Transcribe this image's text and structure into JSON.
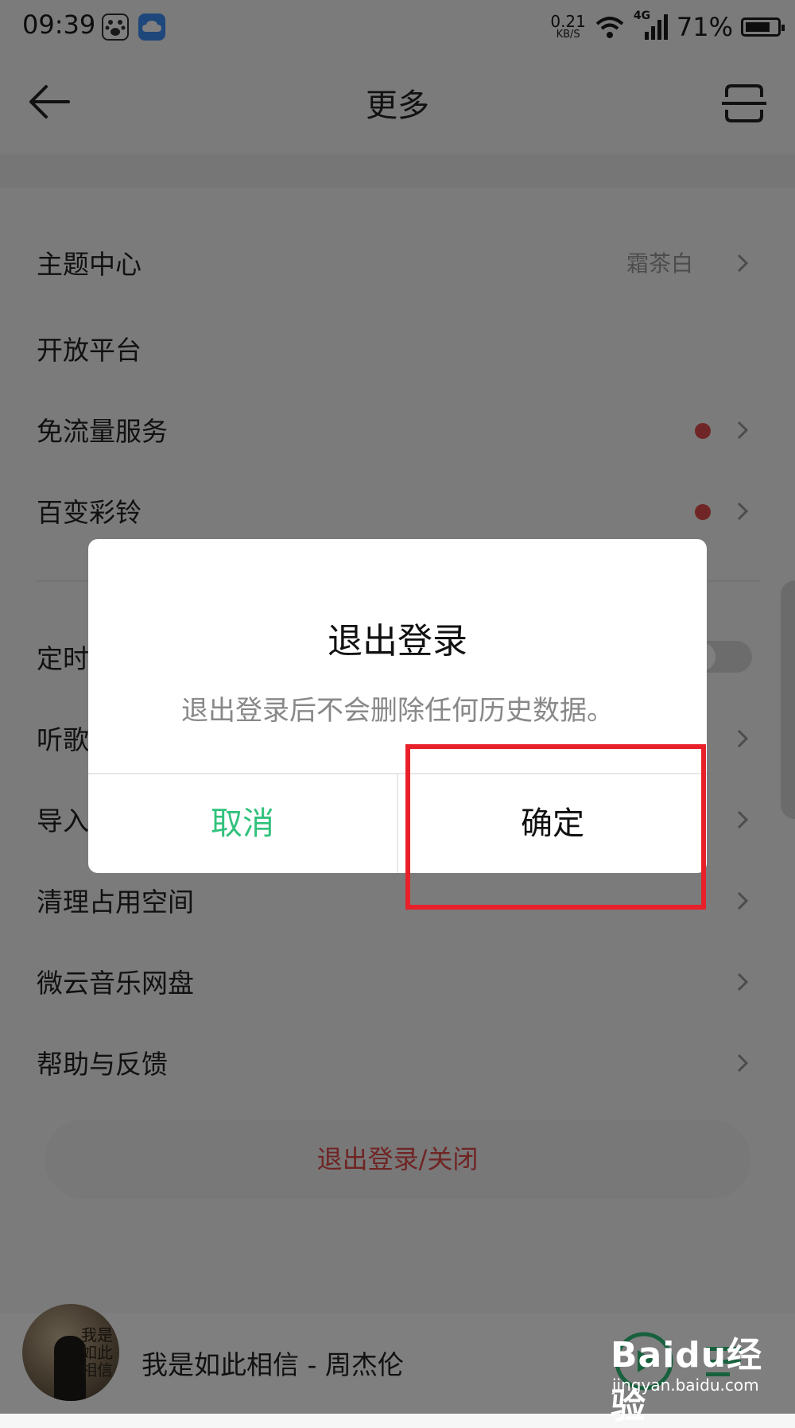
{
  "status_bar": {
    "time": "09:39",
    "net_speed_value": "0.21",
    "net_speed_unit": "KB/S",
    "network": "4G",
    "battery": "71%",
    "icons": [
      "baidu-paw-icon",
      "cloud-icon",
      "wifi-icon",
      "signal-icon",
      "battery-icon"
    ]
  },
  "nav": {
    "title": "更多",
    "icons": [
      "back-arrow-icon",
      "scan-icon"
    ]
  },
  "settings": {
    "theme": {
      "label": "主题中心",
      "value": "霜茶白"
    },
    "open_platform": {
      "label": "开放平台"
    },
    "free_data": {
      "label": "免流量服务"
    },
    "ringtone": {
      "label": "百变彩铃"
    },
    "timer": {
      "label": "定时"
    },
    "listen": {
      "label": "听歌"
    },
    "import": {
      "label": "导入"
    },
    "clean": {
      "label": "清理占用空间"
    },
    "weiyun": {
      "label": "微云音乐网盘"
    },
    "help": {
      "label": "帮助与反馈"
    }
  },
  "logout_button": "退出登录/关闭",
  "player": {
    "album_text": "我是如此相信",
    "song": "我是如此相信 - 周杰伦"
  },
  "dialog": {
    "title": "退出登录",
    "message": "退出登录后不会删除任何历史数据。",
    "cancel": "取消",
    "confirm": "确定"
  },
  "watermark": {
    "main": "Baidu经验",
    "sub": "jingyan.baidu.com"
  },
  "colors": {
    "accent_green": "#31c27c",
    "danger_red": "#e04848",
    "highlight_red": "#e8202a",
    "dot_red": "#e14c4c"
  }
}
